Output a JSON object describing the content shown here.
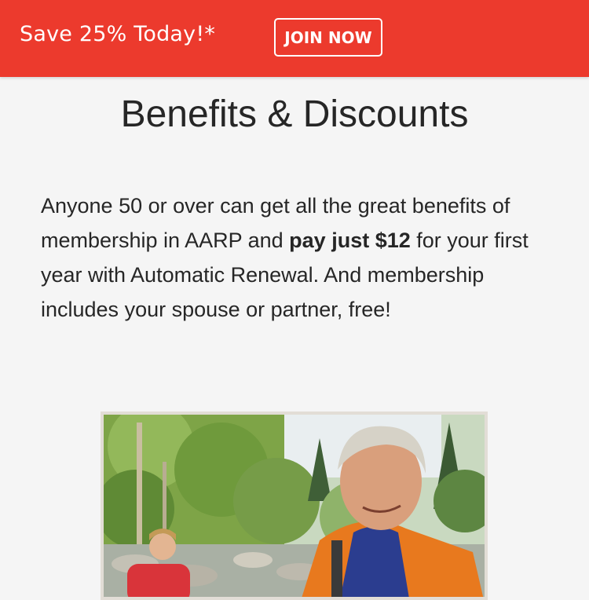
{
  "banner": {
    "promo_text": "Save 25% Today!*",
    "join_label": "JOIN NOW",
    "color": "#ec3a2d"
  },
  "page": {
    "title": "Benefits & Discounts",
    "intro_part1": "Anyone 50 or over can get all the great benefits of membership in AARP and ",
    "intro_bold": "pay just $12",
    "intro_part2": " for your first year with Automatic Renewal. And membership includes your spouse or partner, free!"
  },
  "photo": {
    "subject": "two hikers in a forest by a rocky stream"
  }
}
